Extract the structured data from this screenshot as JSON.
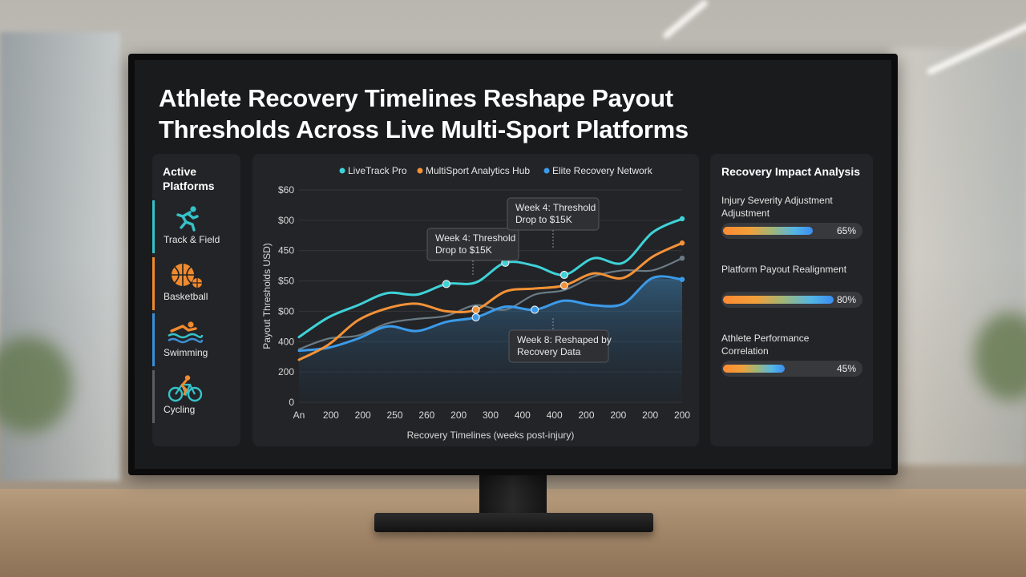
{
  "title": "Athlete Recovery Timelines Reshape Payout Thresholds Across Live Multi-Sport Platforms",
  "sidebar": {
    "title": "Active Platforms",
    "items": [
      {
        "label": "Track & Field",
        "icon": "runner-icon",
        "color": "#35c3c9"
      },
      {
        "label": "Basketball",
        "icon": "basketball-icon",
        "color": "#f08a2e"
      },
      {
        "label": "Swimming",
        "icon": "swimmer-icon",
        "color": "#3b8fd6"
      },
      {
        "label": "Cycling",
        "icon": "cyclist-icon",
        "color": "#5a5d63"
      }
    ]
  },
  "chart_data": {
    "type": "line",
    "legend": [
      {
        "name": "LiveTrack Pro",
        "color": "#3ed2d8"
      },
      {
        "name": "MultiSport Analytics Hub",
        "color": "#f39237"
      },
      {
        "name": "Elite Recovery Network",
        "color": "#3b9bea"
      }
    ],
    "x_tick_labels": [
      "An",
      "200",
      "200",
      "250",
      "260",
      "200",
      "300",
      "400",
      "400",
      "200",
      "200",
      "200",
      "200"
    ],
    "y_tick_labels": [
      "0",
      "200",
      "400",
      "$00",
      "$50",
      "450",
      "$00",
      "$60"
    ],
    "xlabel": "Recovery Timelines (weeks post-injury)",
    "ylabel": "Payout Thresholds USD)",
    "ylim": [
      0,
      7
    ],
    "series": [
      {
        "name": "LiveTrack Pro",
        "color": "#3ed2d8",
        "values": [
          2.15,
          2.8,
          3.2,
          3.6,
          3.55,
          3.9,
          3.95,
          4.6,
          4.5,
          4.2,
          4.75,
          4.6,
          5.6,
          6.05
        ]
      },
      {
        "name": "MultiSport Analytics Hub",
        "color": "#f39237",
        "values": [
          1.4,
          1.9,
          2.7,
          3.1,
          3.25,
          3.0,
          3.05,
          3.65,
          3.75,
          3.85,
          4.25,
          4.1,
          4.8,
          5.25
        ]
      },
      {
        "name": "Elite Recovery Network",
        "color": "#3b9bea",
        "values": [
          1.7,
          1.8,
          2.1,
          2.5,
          2.35,
          2.65,
          2.8,
          3.15,
          3.05,
          3.35,
          3.2,
          3.25,
          4.1,
          4.05
        ]
      },
      {
        "name": "",
        "color": "#6a7b85",
        "values": [
          1.75,
          2.1,
          2.2,
          2.6,
          2.75,
          2.85,
          3.2,
          3.05,
          3.55,
          3.7,
          4.15,
          4.35,
          4.35,
          4.75
        ]
      }
    ],
    "annotations": [
      {
        "text": [
          "Week 4: Threshold",
          "Drop to $15K"
        ],
        "marker": "upper"
      },
      {
        "text": [
          "Week 4: Threshold",
          "Drop to $15K"
        ],
        "marker": "upper"
      },
      {
        "text": [
          "Week 8: Reshaped by",
          "Recovery Data"
        ],
        "marker": "lower"
      }
    ],
    "grid": true
  },
  "analysis": {
    "title": "Recovery Impact Analysis",
    "metrics": [
      {
        "label": "Injury Severity Adjustment Adjustment",
        "value": 0.65,
        "display": "65%"
      },
      {
        "label": "Platform Payout Realignment",
        "value": 0.8,
        "display": "80%"
      },
      {
        "label": "Athlete Performance Correlation",
        "value": 0.45,
        "display": "45%"
      }
    ]
  }
}
